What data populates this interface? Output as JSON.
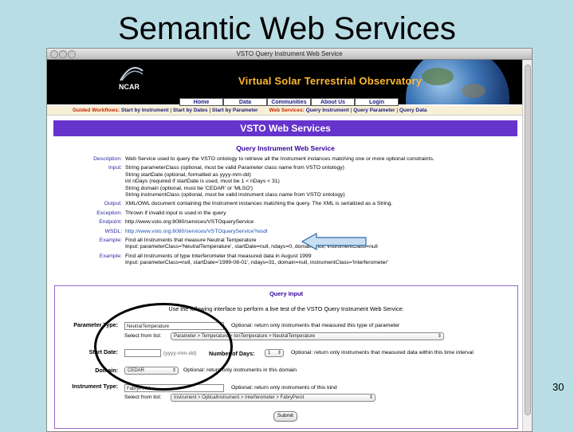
{
  "slide": {
    "title": "Semantic Web Services",
    "page_number": "30"
  },
  "window": {
    "title": "VSTO Query Instrument Web Service"
  },
  "banner": {
    "org": "NCAR",
    "title": "Virtual Solar Terrestrial Observatory"
  },
  "nav": {
    "tabs": [
      "Home",
      "Data",
      "Communities",
      "About Us",
      "Login"
    ]
  },
  "workflows": {
    "guided_label": "Guided Workflows:",
    "guided_items": [
      "Start by Instrument",
      "Start by Dates",
      "Start by Parameter"
    ],
    "web_label": "Web Services:",
    "web_items": [
      "Query Instrument",
      "Query Parameter",
      "Query Data"
    ]
  },
  "service": {
    "header": "VSTO Web Services",
    "subtitle": "Query Instrument Web Service"
  },
  "details": {
    "description_label": "Description:",
    "description": "Web Service used to query the VSTO ontology to retrieve all the Instrument instances matching one or more optional constraints.",
    "input_label": "Input:",
    "input_lines": [
      "String parameterClass (optional, must be valid Parameter class name from VSTO ontology)",
      "String startDate (optional, formatted as yyyy-mm-dd)",
      "int nDays (required if startDate is used, must be 1 < nDays < 31)",
      "String domain (optional, must be 'CEDAR' or 'MLSO')",
      "String instrumentClass (optional, must be valid instrument class name from VSTO ontology)"
    ],
    "output_label": "Output:",
    "output": "XML/OWL document containing the Instrument instances matching the query. The XML is serialized as a String.",
    "exception_label": "Exception:",
    "exception": "Thrown if invalid input is used in the query",
    "endpoint_label": "Endpoint:",
    "endpoint": "http://www.vsto.org:8080/services/VSTOqueryService",
    "wsdl_label": "WSDL:",
    "wsdl": "http://www.vsto.org:8080/services/VSTOqueryService?wsdl",
    "example1_label": "Example:",
    "example1_lines": [
      "Find all Instruments that measure Neutral Temperature",
      "Input: parameterClass='NeutralTemperature', startDate=null, ndays=0, domain=null, instrumentClass=null"
    ],
    "example2_label": "Example:",
    "example2_lines": [
      "Find all Instruments of type Interferometer that measured data in August 1999",
      "Input: parameterClass=null, startDate='1999-08-01', ndays=31, domain=null, instrumentClass='Interferometer'"
    ]
  },
  "query": {
    "title": "Query Input",
    "intro": "Use the following interface to perform a live test of the VSTO Query Instrument Web Service:",
    "parameter_label": "Parameter Type:",
    "parameter_value": "NeutralTemperature",
    "parameter_hint": "Optional: return only instruments that measured this type of parameter",
    "parameter_select_label": "Select from list:",
    "parameter_select_value": "Parameter > Temperature > IonTemperature > NeutralTemperature",
    "start_date_label": "Start Date:",
    "start_date_placeholder": "(yyyy-mm-dd)",
    "ndays_label": "Number of Days:",
    "ndays_value": "1",
    "ndays_hint": "Optional: return only instruments that measured data within this time interval",
    "domain_label": "Domain:",
    "domain_value": "CEDAR",
    "domain_hint": "Optional: return only instruments in this domain",
    "instrument_label": "Instrument Type:",
    "instrument_value": "FabryPerot",
    "instrument_hint": "Optional: return only instruments of this kind",
    "instrument_select_label": "Select from list:",
    "instrument_select_value": "Instrument > OpticalInstrument > Interferometer > FabryPerot",
    "submit_label": "Submit"
  },
  "colors": {
    "background": "#b9dde5",
    "header": "#6633cc",
    "link": "#1a4fb0",
    "banner_title": "#ffb833"
  }
}
